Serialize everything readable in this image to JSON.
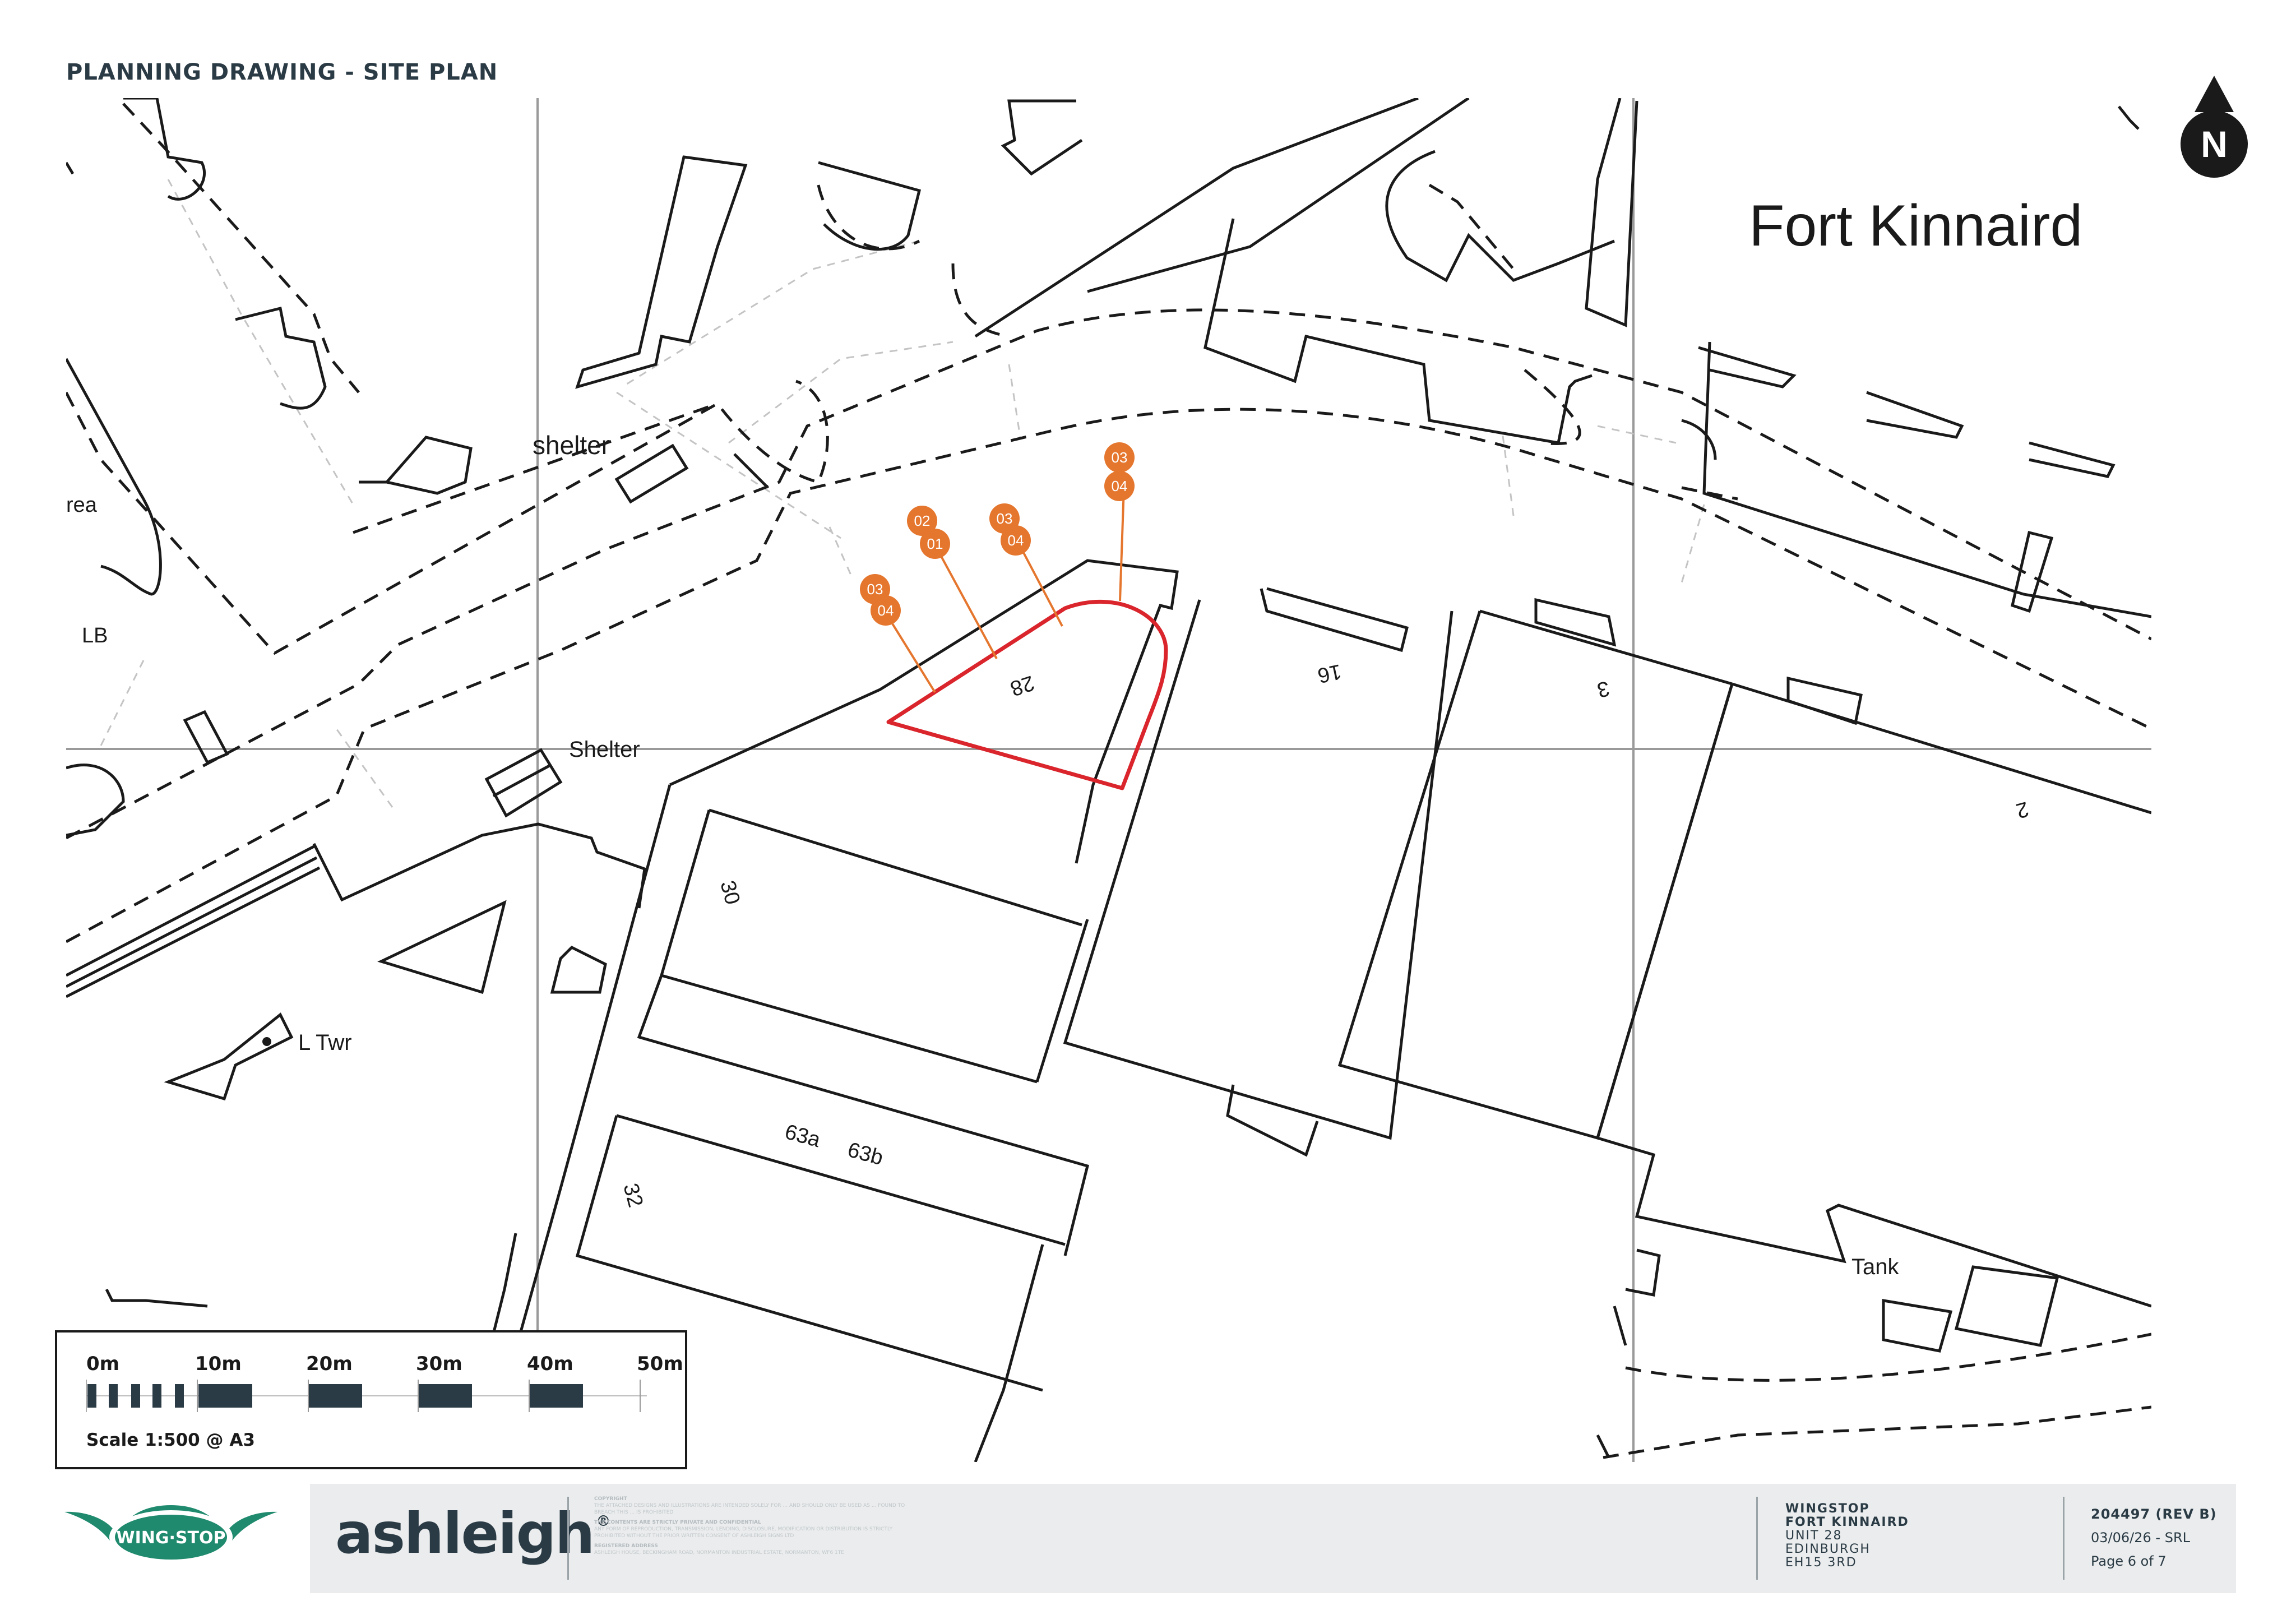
{
  "header": {
    "title": "PLANNING DRAWING - SITE PLAN"
  },
  "map": {
    "place_name": "Fort Kinnaird",
    "north_label": "N",
    "labels": {
      "shelter_lower": "shelter",
      "shelter_upper": "Shelter",
      "area": "rea",
      "lb": "LB",
      "l_twr": "L Twr",
      "tank": "Tank",
      "unit_28": "28",
      "unit_16": "16",
      "unit_3": "3",
      "unit_2": "2",
      "unit_30": "30",
      "unit_32": "32",
      "unit_63a": "63a",
      "unit_63b": "63b"
    },
    "markers": [
      {
        "top": "03",
        "bottom": "04"
      },
      {
        "top": "02",
        "bottom": "01"
      },
      {
        "top": "03",
        "bottom": "04"
      },
      {
        "top": "03",
        "bottom": "04"
      }
    ],
    "colors": {
      "marker": "#e5762e",
      "site_boundary": "#d9252b"
    }
  },
  "scale_bar": {
    "ticks": [
      "0m",
      "10m",
      "20m",
      "30m",
      "40m",
      "50m"
    ],
    "caption": "Scale 1:500 @ A3"
  },
  "footer": {
    "brand_logo_text": "WING·STOP",
    "company": "ashleigh",
    "company_mark": "®",
    "fine_print": {
      "copyright_heading": "COPYRIGHT",
      "copyright_text": "THE ATTACHED DESIGNS AND ILLUSTRATIONS ARE INTENDED SOLELY FOR ... AND SHOULD ONLY BE USED AS ... FOUND TO BREACH THIS ... IS PROHIBITED",
      "confidential_heading": "THE CONTENTS ARE STRICTLY PRIVATE AND CONFIDENTIAL",
      "confidential_text": "ANY FORM OF REPRODUCTION, TRANSMISSION, LENDING, DISCLOSURE, MODIFICATION OR DISTRIBUTION IS STRICTLY PROHIBITED WITHOUT THE PRIOR WRITTEN CONSENT OF ASHLEIGH SIGNS LTD",
      "address_heading": "REGISTERED ADDRESS",
      "address_text": "ASHLEIGH HOUSE, BECKINGHAM ROAD, NORMANTON INDUSTRIAL ESTATE, NORMANTON, WF6 1TE"
    },
    "project": {
      "client": "WINGSTOP",
      "site": "FORT KINNAIRD",
      "unit": "UNIT 28",
      "city": "EDINBURGH",
      "postcode": "EH15 3RD"
    },
    "reference": {
      "number": "204497 (REV B)",
      "date_author": "03/06/26 - SRL",
      "page": "Page 6 of 7"
    }
  }
}
